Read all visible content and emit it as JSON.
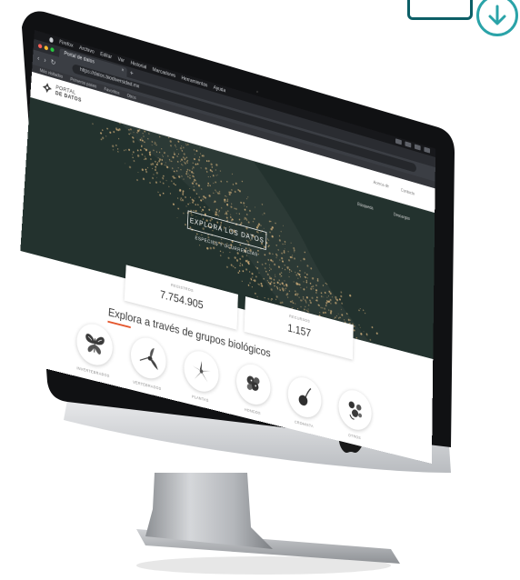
{
  "colors": {
    "accent": "#e4572e",
    "hero_bg": "#23322e",
    "map_points": "#c9a977",
    "badge_dark": "#0c5e66",
    "badge_light": "#2aa3a8"
  },
  "menubar": {
    "items": [
      "Firefox",
      "Archivo",
      "Editar",
      "Ver",
      "Historial",
      "Marcadores",
      "Herramientas",
      "Ayuda"
    ]
  },
  "browser": {
    "tab_title": "Portal de datos",
    "url": "https://datos.biodiversidad.mx"
  },
  "bookmarks": [
    "Más visitados",
    "Primeros pasos",
    "Favoritos",
    "Otros"
  ],
  "site": {
    "logo_line1": "PORTAL",
    "logo_line2": "DE DATOS",
    "header_links": [
      "Acerca de",
      "Contacto"
    ],
    "hero_cta": "EXPLORA LOS DATOS",
    "hero_sub": "ESPECIES Y OCURRENCIAS",
    "hero_side_links": [
      "Búsqueda",
      "Descargas"
    ]
  },
  "stats": [
    {
      "label": "REGISTROS",
      "value": "7.754.905"
    },
    {
      "label": "RECURSOS",
      "value": "1.157"
    }
  ],
  "explore": {
    "title": "Explora a través de grupos biológicos",
    "groups": [
      {
        "label": "INVERTEBRADOS",
        "icon": "butterfly-icon"
      },
      {
        "label": "VERTEBRADOS",
        "icon": "hummingbird-icon"
      },
      {
        "label": "PLANTAS",
        "icon": "flower-icon"
      },
      {
        "label": "HONGOS",
        "icon": "fungi-icon"
      },
      {
        "label": "CROMISTA",
        "icon": "algae-icon"
      },
      {
        "label": "OTROS",
        "icon": "other-icon"
      }
    ]
  }
}
